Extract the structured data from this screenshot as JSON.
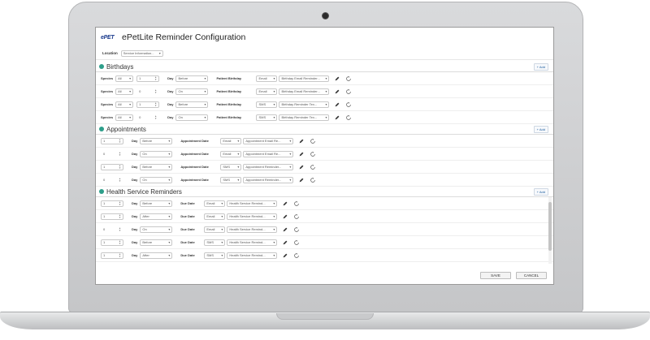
{
  "app": {
    "logo_text": "ePET",
    "title": "ePetLite Reminder Configuration"
  },
  "location": {
    "label": "Location",
    "value": "Service Information..."
  },
  "sections": {
    "birthdays": {
      "title": "Birthdays",
      "add_label": "+ Add",
      "rows": [
        {
          "species_label": "Species",
          "species": "All",
          "qty": "1",
          "day_label": "Day",
          "day": "Before",
          "type_label": "Patient Birthday",
          "method": "Email",
          "template": "Birthday Email Reminder..."
        },
        {
          "species_label": "Species",
          "species": "All",
          "qty": "0",
          "day_label": "Day",
          "day": "On",
          "type_label": "Patient Birthday",
          "method": "Email",
          "template": "Birthday Email Reminder..."
        },
        {
          "species_label": "Species",
          "species": "All",
          "qty": "1",
          "day_label": "Day",
          "day": "Before",
          "type_label": "Patient Birthday",
          "method": "SMS",
          "template": "Birthday Reminder Tex..."
        },
        {
          "species_label": "Species",
          "species": "All",
          "qty": "0",
          "day_label": "Day",
          "day": "On",
          "type_label": "Patient Birthday",
          "method": "SMS",
          "template": "Birthday Reminder Tex..."
        }
      ]
    },
    "appointments": {
      "title": "Appointments",
      "add_label": "+ Add",
      "rows": [
        {
          "qty": "1",
          "day_label": "Day",
          "day": "Before",
          "type_label": "Appointment Date",
          "method": "Email",
          "template": "Appointment Email Re..."
        },
        {
          "qty": "0",
          "day_label": "Day",
          "day": "On",
          "type_label": "Appointment Date",
          "method": "Email",
          "template": "Appointment Email Re..."
        },
        {
          "qty": "1",
          "day_label": "Day",
          "day": "Before",
          "type_label": "Appointment Date",
          "method": "SMS",
          "template": "Appointment Reminder..."
        },
        {
          "qty": "0",
          "day_label": "Day",
          "day": "On",
          "type_label": "Appointment Date",
          "method": "SMS",
          "template": "Appointment Reminder..."
        }
      ]
    },
    "health": {
      "title": "Health Service Reminders",
      "add_label": "+ Add",
      "rows": [
        {
          "qty": "1",
          "day_label": "Day",
          "day": "Before",
          "type_label": "Due Date",
          "method": "Email",
          "template": "Health Service Remind..."
        },
        {
          "qty": "1",
          "day_label": "Day",
          "day": "After",
          "type_label": "Due Date",
          "method": "Email",
          "template": "Health Service Remind..."
        },
        {
          "qty": "0",
          "day_label": "Day",
          "day": "On",
          "type_label": "Due Date",
          "method": "Email",
          "template": "Health Service Remind..."
        },
        {
          "qty": "1",
          "day_label": "Day",
          "day": "Before",
          "type_label": "Due Date",
          "method": "SMS",
          "template": "Health Service Remind..."
        },
        {
          "qty": "1",
          "day_label": "Day",
          "day": "After",
          "type_label": "Due Date",
          "method": "SMS",
          "template": "Health Service Remind..."
        }
      ]
    }
  },
  "footer": {
    "save_label": "SAVE",
    "cancel_label": "CANCEL"
  },
  "colors": {
    "accent": "#2d9e8a",
    "link": "#2060a0"
  }
}
